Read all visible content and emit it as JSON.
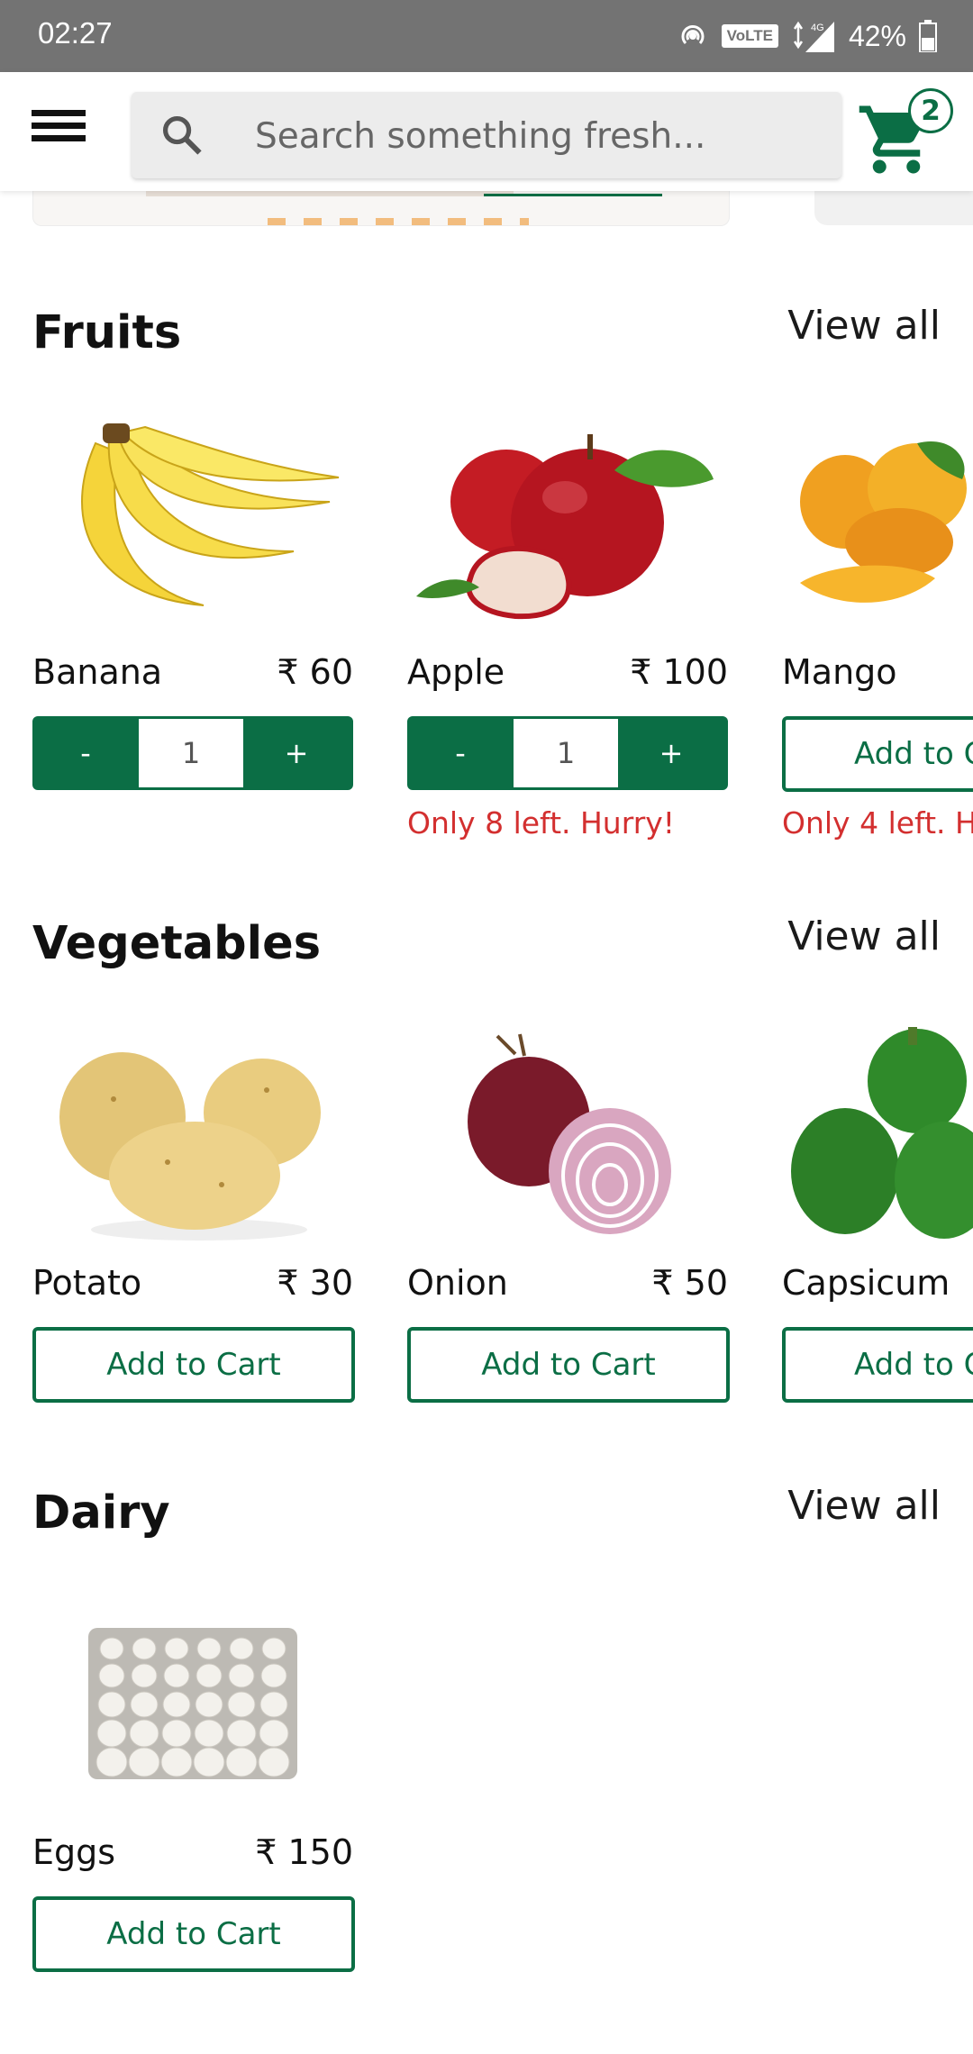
{
  "status_bar": {
    "time": "02:27",
    "network": "VoLTE",
    "signal": "4G",
    "battery": "42%"
  },
  "search": {
    "placeholder": "Search something fresh..."
  },
  "cart": {
    "count": "2"
  },
  "colors": {
    "brand": "#0b6e45",
    "warning": "#d32f2f"
  },
  "sections": [
    {
      "title": "Fruits",
      "view_all": "View all",
      "products": [
        {
          "name": "Banana",
          "price": "₹ 60",
          "quantity": "1"
        },
        {
          "name": "Apple",
          "price": "₹ 100",
          "quantity": "1",
          "stock": "Only 8 left. Hurry!"
        },
        {
          "name": "Mango",
          "button": "Add to C",
          "stock": "Only 4 left. H"
        }
      ]
    },
    {
      "title": "Vegetables",
      "view_all": "View all",
      "products": [
        {
          "name": "Potato",
          "price": "₹ 30",
          "button": "Add to Cart"
        },
        {
          "name": "Onion",
          "price": "₹ 50",
          "button": "Add to Cart"
        },
        {
          "name": "Capsicum",
          "button": "Add to C"
        }
      ]
    },
    {
      "title": "Dairy",
      "view_all": "View all",
      "products": [
        {
          "name": "Eggs",
          "price": "₹ 150",
          "button": "Add to Cart"
        }
      ]
    }
  ],
  "stepper": {
    "minus": "-",
    "plus": "+"
  }
}
